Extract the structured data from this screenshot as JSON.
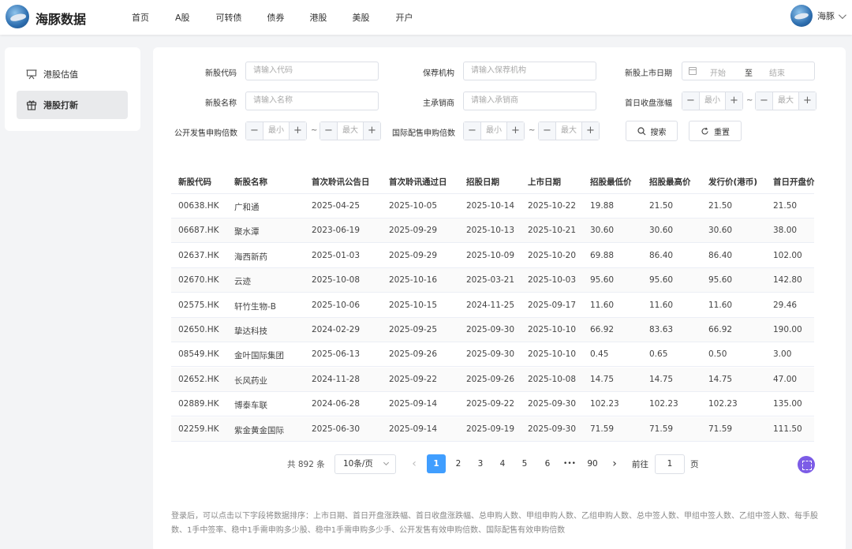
{
  "brand": {
    "name": "海豚数据"
  },
  "nav": [
    "首页",
    "A股",
    "可转债",
    "债券",
    "港股",
    "美股",
    "开户"
  ],
  "user": {
    "name": "海豚"
  },
  "sidebar": {
    "items": [
      {
        "label": "港股估值",
        "icon": "chart-board-icon"
      },
      {
        "label": "港股打新",
        "icon": "gift-icon"
      }
    ],
    "active": 1
  },
  "filters": {
    "code_label": "新股代码",
    "code_ph": "请输入代码",
    "sponsor_label": "保荐机构",
    "sponsor_ph": "请输入保荐机构",
    "listdate_label": "新股上市日期",
    "start_ph": "开始",
    "to": "至",
    "end_ph": "结束",
    "name_label": "新股名称",
    "name_ph": "请输入名称",
    "underwriter_label": "主承销商",
    "underwriter_ph": "请输入承销商",
    "firstday_label": "首日收盘涨幅",
    "public_label": "公开发售申购倍数",
    "intl_label": "国际配售申购倍数",
    "min_ph": "最小",
    "max_ph": "最大",
    "tilde": "~",
    "search_btn": "搜索",
    "reset_btn": "重置"
  },
  "table": {
    "headers": [
      "新股代码",
      "新股名称",
      "首次聆讯公告日",
      "首次聆讯通过日",
      "招股日期",
      "上市日期",
      "招股最低价",
      "招股最高价",
      "发行价(港币)",
      "首日开盘价"
    ],
    "rows": [
      [
        "00638.HK",
        "广和通",
        "2025-04-25",
        "2025-10-05",
        "2025-10-14",
        "2025-10-22",
        "19.88",
        "21.50",
        "21.50",
        "21.50"
      ],
      [
        "06687.HK",
        "聚水潭",
        "2023-06-19",
        "2025-09-29",
        "2025-10-13",
        "2025-10-21",
        "30.60",
        "30.60",
        "30.60",
        "38.00"
      ],
      [
        "02637.HK",
        "海西新药",
        "2025-01-03",
        "2025-09-29",
        "2025-10-09",
        "2025-10-20",
        "69.88",
        "86.40",
        "86.40",
        "102.00"
      ],
      [
        "02670.HK",
        "云迹",
        "2025-10-08",
        "2025-10-16",
        "2025-03-21",
        "2025-10-03",
        "95.60",
        "95.60",
        "95.60",
        "142.80"
      ],
      [
        "02575.HK",
        "轩竹生物-B",
        "2025-10-06",
        "2025-10-15",
        "2024-11-25",
        "2025-09-17",
        "11.60",
        "11.60",
        "11.60",
        "29.46"
      ],
      [
        "02650.HK",
        "挚达科技",
        "2024-02-29",
        "2025-09-25",
        "2025-09-30",
        "2025-10-10",
        "66.92",
        "83.63",
        "66.92",
        "190.00"
      ],
      [
        "08549.HK",
        "金叶国际集团",
        "2025-06-13",
        "2025-09-26",
        "2025-09-30",
        "2025-10-10",
        "0.45",
        "0.65",
        "0.50",
        "3.00"
      ],
      [
        "02652.HK",
        "长风药业",
        "2024-11-28",
        "2025-09-22",
        "2025-09-26",
        "2025-10-08",
        "14.75",
        "14.75",
        "14.75",
        "47.00"
      ],
      [
        "02889.HK",
        "博泰车联",
        "2024-06-28",
        "2025-09-14",
        "2025-09-22",
        "2025-09-30",
        "102.23",
        "102.23",
        "102.23",
        "135.00"
      ],
      [
        "02259.HK",
        "紫金黄金国际",
        "2025-06-30",
        "2025-09-14",
        "2025-09-19",
        "2025-09-30",
        "71.59",
        "71.59",
        "71.59",
        "111.50"
      ]
    ]
  },
  "pagination": {
    "total": "共 892 条",
    "page_size": "10条/页",
    "pages": [
      "1",
      "2",
      "3",
      "4",
      "5",
      "6",
      "•••",
      "90"
    ],
    "current": "1",
    "prev": "‹",
    "next": "›",
    "goto": "前往",
    "goto_value": "1",
    "page_unit": "页"
  },
  "note": "登录后，可以点击以下字段将数据排序：上市日期、首日开盘涨跌幅、首日收盘涨跌幅、总申购人数、甲组申购人数、乙组申购人数、总中签人数、甲组中签人数、乙组中签人数、每手股数、1手中签率、稳中1手需申购多少股、稳中1手需申购多少手、公开发售有效申购倍数、国际配售有效申购倍数"
}
